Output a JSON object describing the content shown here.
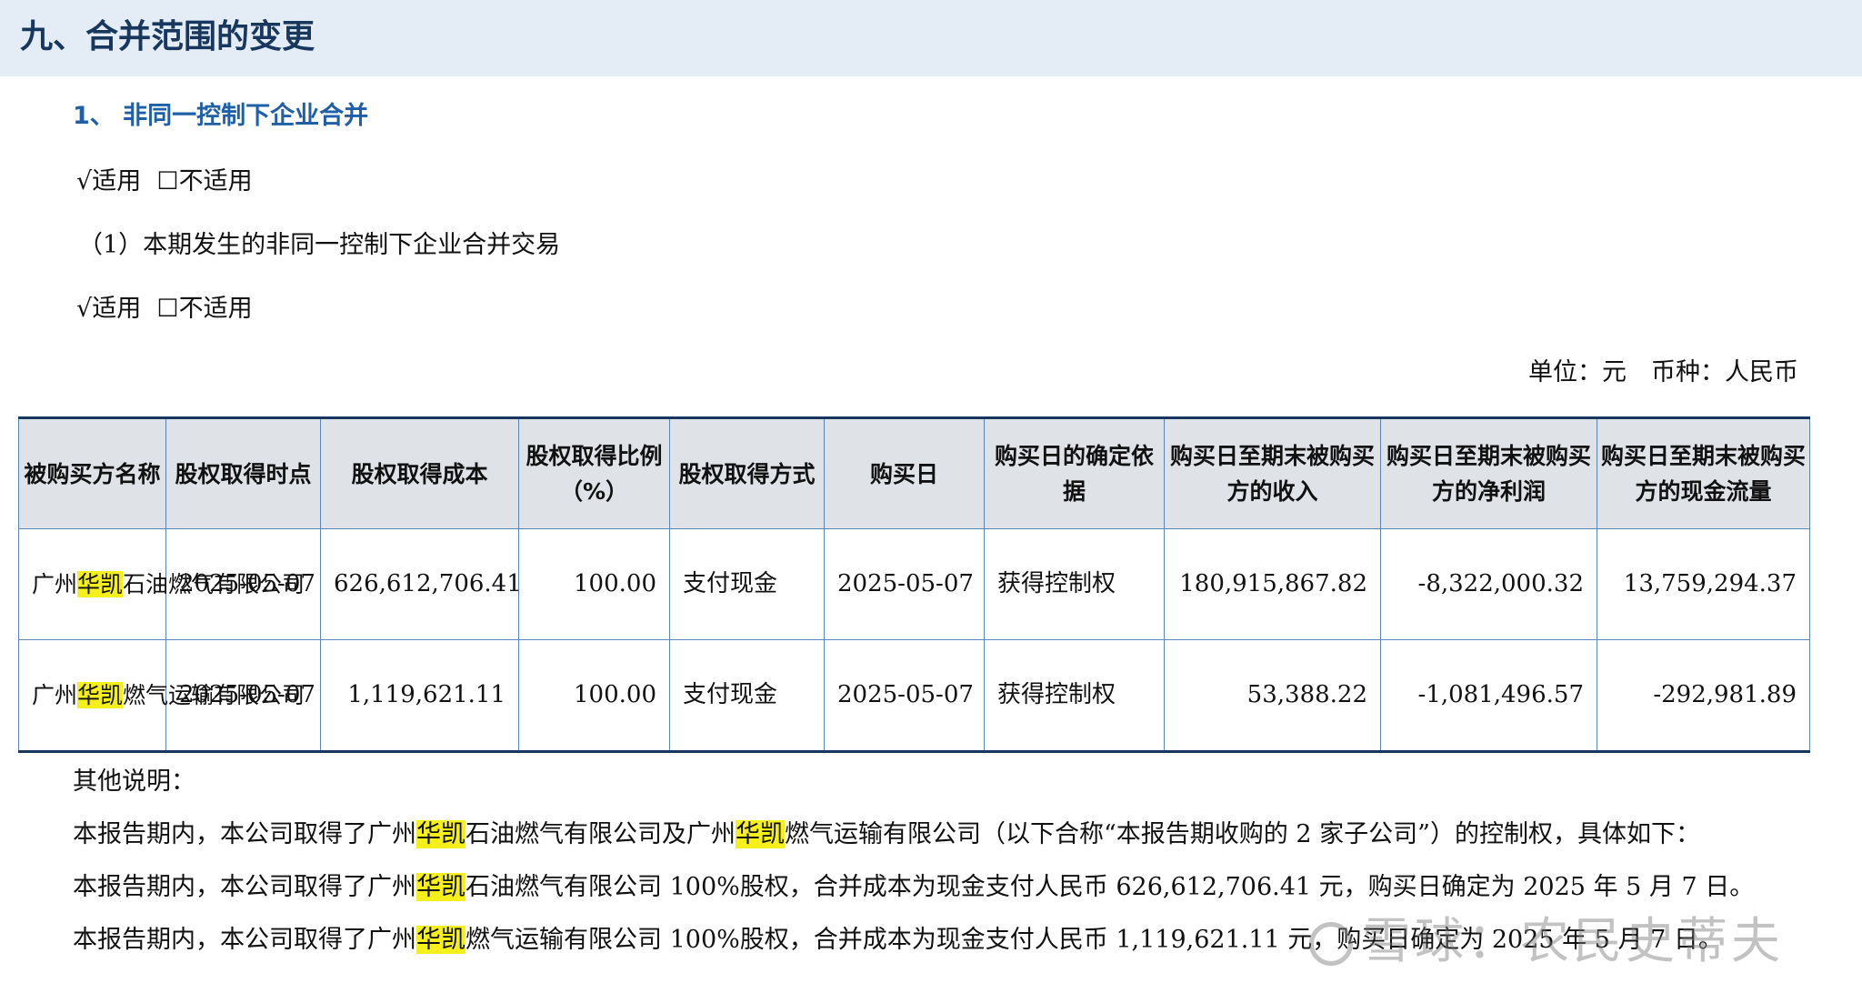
{
  "section": {
    "title": "九、合并范围的变更"
  },
  "subsection": {
    "title": "1、 非同一控制下企业合并"
  },
  "applicability_1": {
    "check": "√",
    "yes": "适用",
    "box": "☐",
    "no": "不适用"
  },
  "transaction_title": "（1）本期发生的非同一控制下企业合并交易",
  "applicability_2": {
    "check": "√",
    "yes": "适用",
    "box": "☐",
    "no": "不适用"
  },
  "unit_line": "单位：元　币种：人民币",
  "table": {
    "headers": [
      "被购买方名称",
      "股权取得时点",
      "股权取得成本",
      "股权取得比例（%）",
      "股权取得方式",
      "购买日",
      "购买日的确定依据",
      "购买日至期末被购买方的收入",
      "购买日至期末被购买方的净利润",
      "购买日至期末被购买方的现金流量"
    ],
    "rows": [
      {
        "name_prefix": "广州",
        "name_highlight": "华凯",
        "name_suffix": "石油燃气有限公司",
        "time": "2025-05-07",
        "cost": "626,612,706.41",
        "ratio": "100.00",
        "method": "支付现金",
        "purchase_date": "2025-05-07",
        "basis": "获得控制权",
        "revenue": "180,915,867.82",
        "net_profit": "-8,322,000.32",
        "cash_flow": "13,759,294.37"
      },
      {
        "name_prefix": "广州",
        "name_highlight": "华凯",
        "name_suffix": "燃气运输有限公司",
        "time": "2025-05-07",
        "cost": "1,119,621.11",
        "ratio": "100.00",
        "method": "支付现金",
        "purchase_date": "2025-05-07",
        "basis": "获得控制权",
        "revenue": "53,388.22",
        "net_profit": "-1,081,496.57",
        "cash_flow": "-292,981.89"
      }
    ]
  },
  "notes": {
    "label": "其他说明：",
    "line1": {
      "a": "本报告期内，本公司取得了广州",
      "h1": "华凯",
      "b": "石油燃气有限公司及广州",
      "h2": "华凯",
      "c": "燃气运输有限公司（以下合称“本报告期收购的 2 家子公司”）的控制权，具体如下："
    },
    "line2": {
      "a": "本报告期内，本公司取得了广州",
      "h1": "华凯",
      "b": "石油燃气有限公司 100%股权，合并成本为现金支付人民币 626,612,706.41 元，购买日确定为 2025 年 5 月 7 日。"
    },
    "line3": {
      "a": "本报告期内，本公司取得了广州",
      "h1": "华凯",
      "b": "燃气运输有限公司 100%股权，合并成本为现金支付人民币 1,119,621.11 元，购买日确定为 2025 年 5 月 7 日。"
    }
  },
  "watermark": {
    "text": "雪球：农民史蒂夫"
  }
}
